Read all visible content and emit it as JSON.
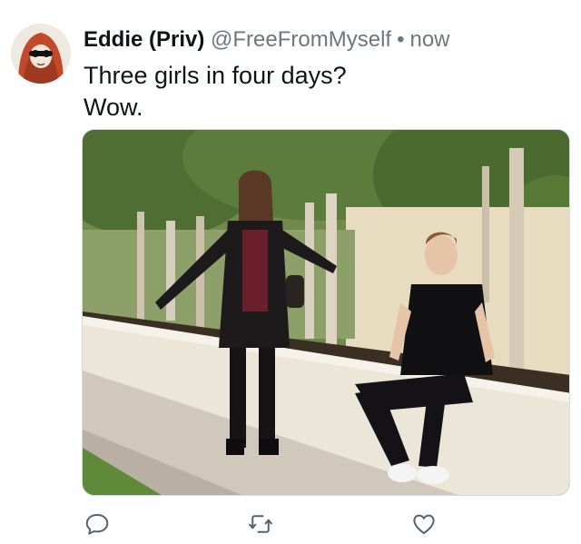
{
  "tweet": {
    "author_name": "Eddie (Priv)",
    "author_handle": "@FreeFromMyself",
    "separator": "•",
    "timestamp": "now",
    "text_lines": [
      "Three girls in four days?",
      "Wow."
    ]
  },
  "avatar": {
    "icon": "hooded-figure-with-sunglasses-avatar"
  },
  "media": {
    "description_icon": "photo"
  },
  "actions": [
    {
      "icon": "reply-icon"
    },
    {
      "icon": "retweet-icon"
    },
    {
      "icon": "like-icon"
    }
  ],
  "colors": {
    "text": "#0f1419",
    "secondary_text": "#6e767d",
    "icon": "#536471",
    "avatar_hood": "#c04a2a"
  }
}
